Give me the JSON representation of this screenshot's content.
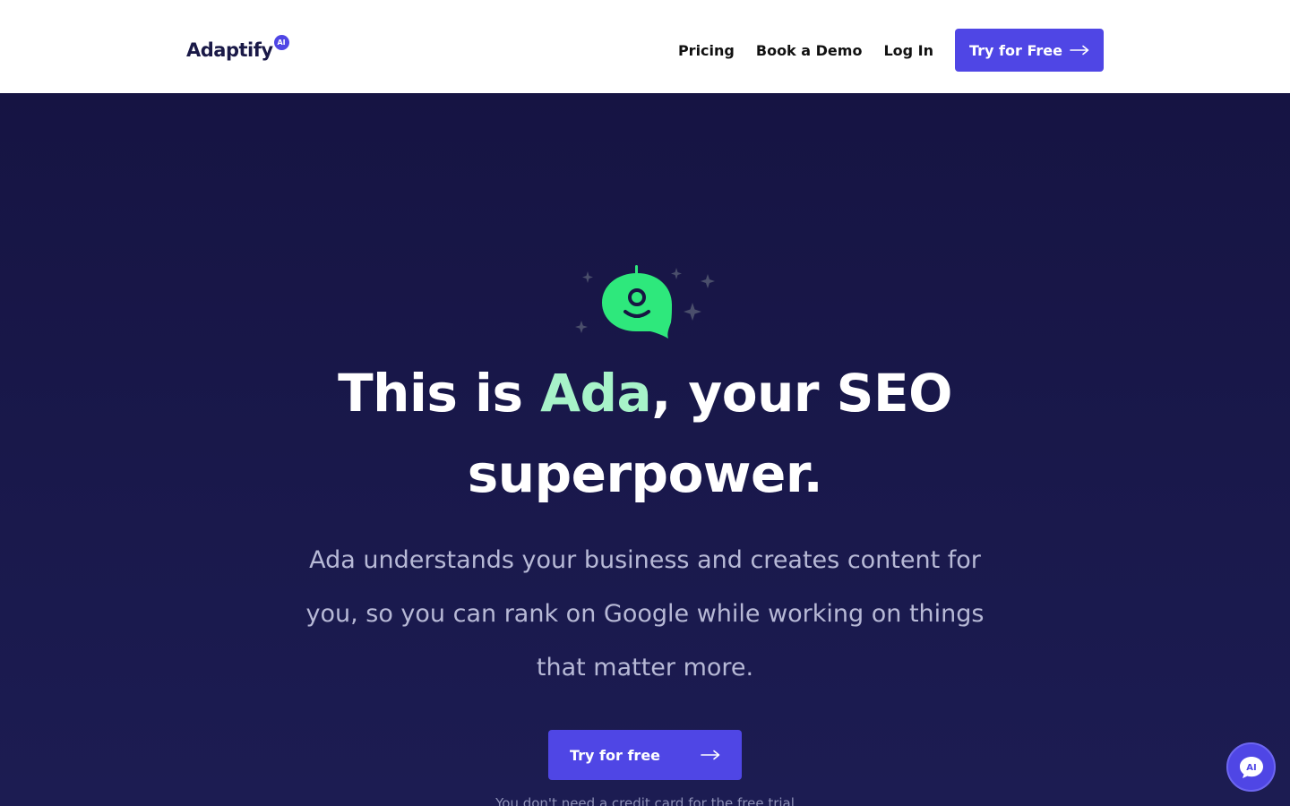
{
  "brand": {
    "name": "Adaptify",
    "badge": "AI",
    "accent_color": "#4f46e5",
    "highlight_color": "#a7f3c9",
    "mascot_color": "#2ee87c"
  },
  "nav": {
    "pricing": "Pricing",
    "book_demo": "Book a Demo",
    "login": "Log In",
    "cta": "Try for Free",
    "cta_icon": "arrow-right-icon"
  },
  "hero": {
    "mascot_icon": "ai-chat-bot-icon",
    "headline_prefix": "This is ",
    "headline_accent": "Ada",
    "headline_suffix": ", your SEO superpower.",
    "subtext": "Ada understands your business and creates content for you, so you can rank on Google while working on things that matter more.",
    "cta": "Try for free",
    "cta_icon": "arrow-right-icon",
    "note": "You don't need a credit card for the free trial"
  },
  "chat_widget": {
    "icon": "ai-chat-bubble-icon",
    "label": "AI"
  }
}
